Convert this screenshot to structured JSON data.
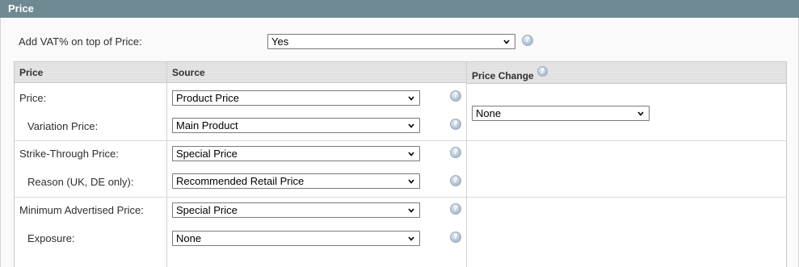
{
  "section": {
    "title": "Price"
  },
  "vat": {
    "label": "Add VAT% on top of Price:",
    "value": "Yes"
  },
  "table": {
    "headers": {
      "price": "Price",
      "source": "Source",
      "price_change": "Price Change"
    },
    "rows": [
      {
        "label": "Price:",
        "value": "Product Price"
      },
      {
        "label": "Variation Price:",
        "value": "Main Product"
      },
      {
        "label": "Strike-Through Price:",
        "value": "Special Price"
      },
      {
        "label": "Reason (UK, DE only):",
        "value": "Recommended Retail Price"
      },
      {
        "label": "Minimum Advertised Price:",
        "value": "Special Price"
      },
      {
        "label": "Exposure:",
        "value": "None"
      }
    ],
    "price_change_value": "None"
  },
  "colors": {
    "header_bar": "#6f8992",
    "help_icon": "#b7c6d6"
  },
  "icons": {
    "help": "help-icon",
    "dropdown": "chevron-down-icon"
  }
}
